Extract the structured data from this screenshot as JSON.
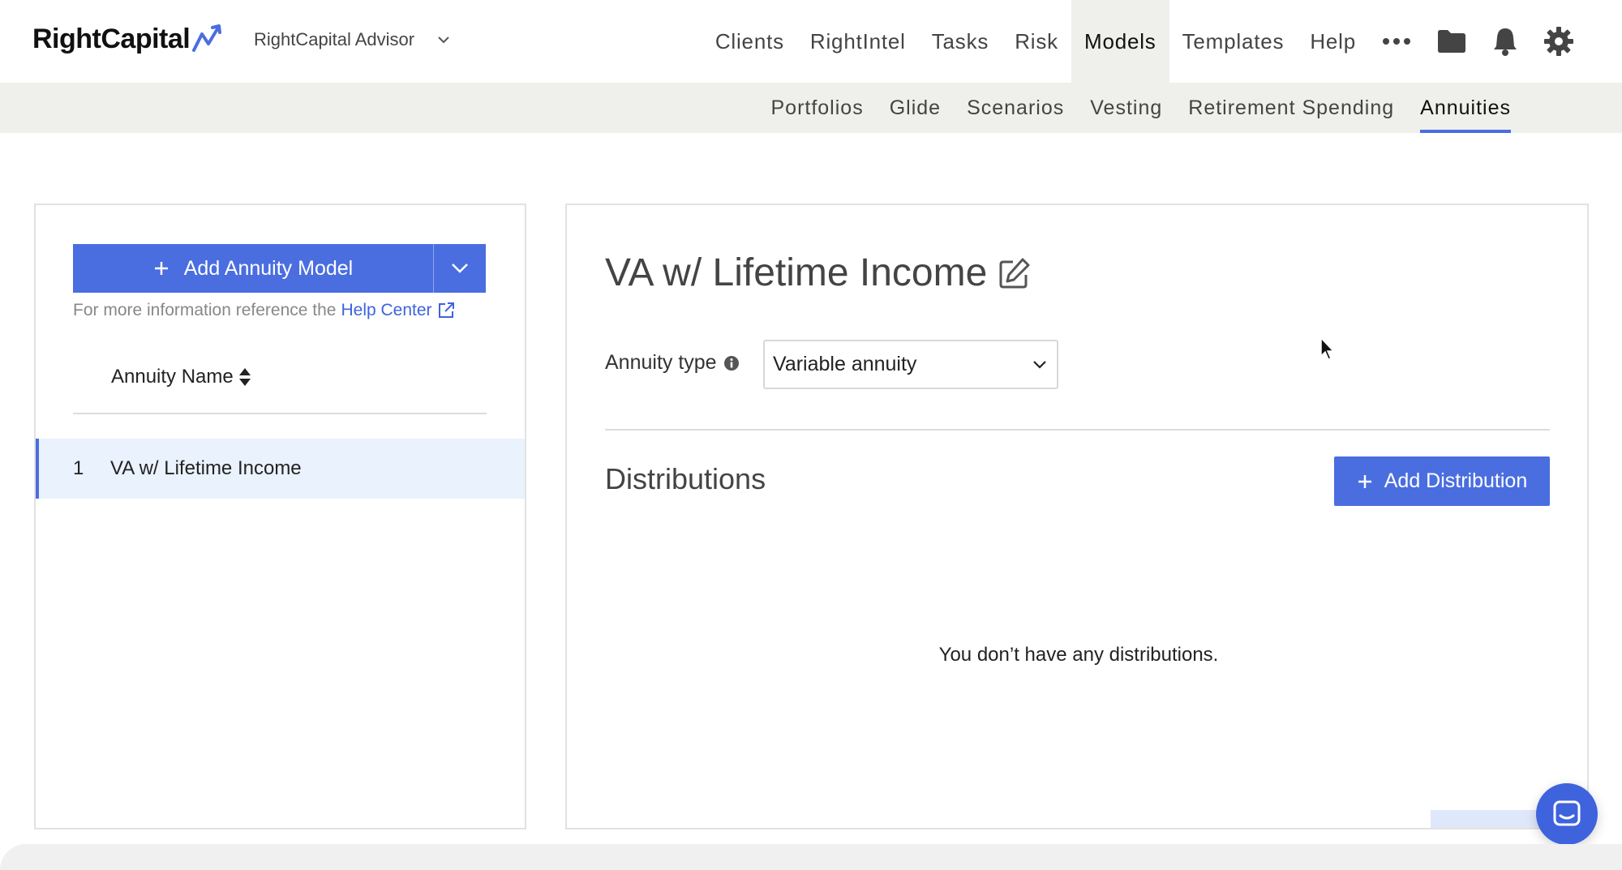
{
  "brand": {
    "logo_text": "RightCapital",
    "accent": "#4a6ee0",
    "account": "RightCapital Advisor"
  },
  "nav": {
    "items": [
      {
        "label": "Clients",
        "active": false
      },
      {
        "label": "RightIntel",
        "active": false
      },
      {
        "label": "Tasks",
        "active": false
      },
      {
        "label": "Risk",
        "active": false
      },
      {
        "label": "Models",
        "active": true
      },
      {
        "label": "Templates",
        "active": false
      },
      {
        "label": "Help",
        "active": false
      }
    ],
    "icons": [
      "more-icon",
      "folder-icon",
      "bell-icon",
      "gear-icon"
    ]
  },
  "subnav": {
    "items": [
      {
        "label": "Portfolios",
        "active": false
      },
      {
        "label": "Glide",
        "active": false
      },
      {
        "label": "Scenarios",
        "active": false
      },
      {
        "label": "Vesting",
        "active": false
      },
      {
        "label": "Retirement Spending",
        "active": false
      },
      {
        "label": "Annuities",
        "active": true
      }
    ]
  },
  "sidebar": {
    "add_button_label": "Add Annuity Model",
    "help_prefix": "For more information reference the",
    "help_link": "Help Center",
    "column_header": "Annuity Name",
    "rows": [
      {
        "index": "1",
        "name": "VA w/ Lifetime Income",
        "selected": true
      }
    ]
  },
  "detail": {
    "title": "VA w/ Lifetime Income",
    "annuity_type_label": "Annuity type",
    "annuity_type_value": "Variable annuity",
    "distributions_title": "Distributions",
    "add_distribution_label": "Add Distribution",
    "empty_message": "You don’t have any distributions."
  }
}
